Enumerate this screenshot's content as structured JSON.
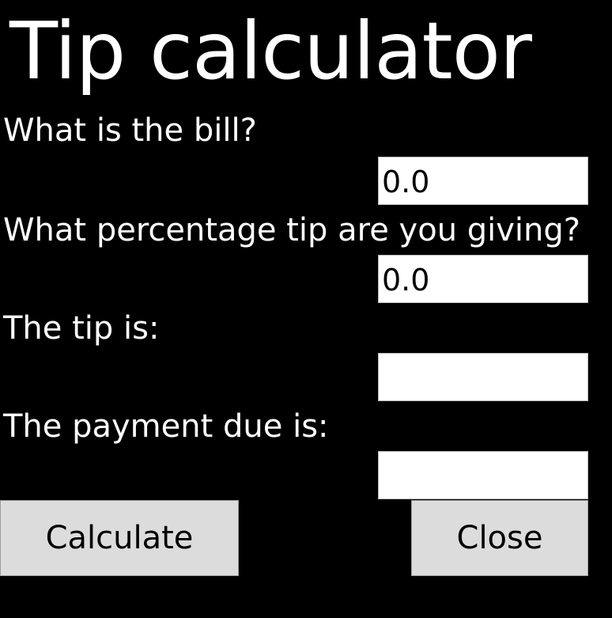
{
  "app": {
    "title": "Tip calculator"
  },
  "form": {
    "bill_label": "What is the bill?",
    "bill_value": "0.0",
    "percent_label": "What percentage tip are you giving?",
    "percent_value": "0.0",
    "tip_label": "The tip is:",
    "tip_value": "",
    "payment_label": "The payment due is:",
    "payment_value": ""
  },
  "buttons": {
    "calculate_label": "Calculate",
    "close_label": "Close"
  },
  "colors": {
    "background": "#000000",
    "text": "#ffffff",
    "field_background": "#ffffff",
    "button_background": "#dcdcdc"
  }
}
